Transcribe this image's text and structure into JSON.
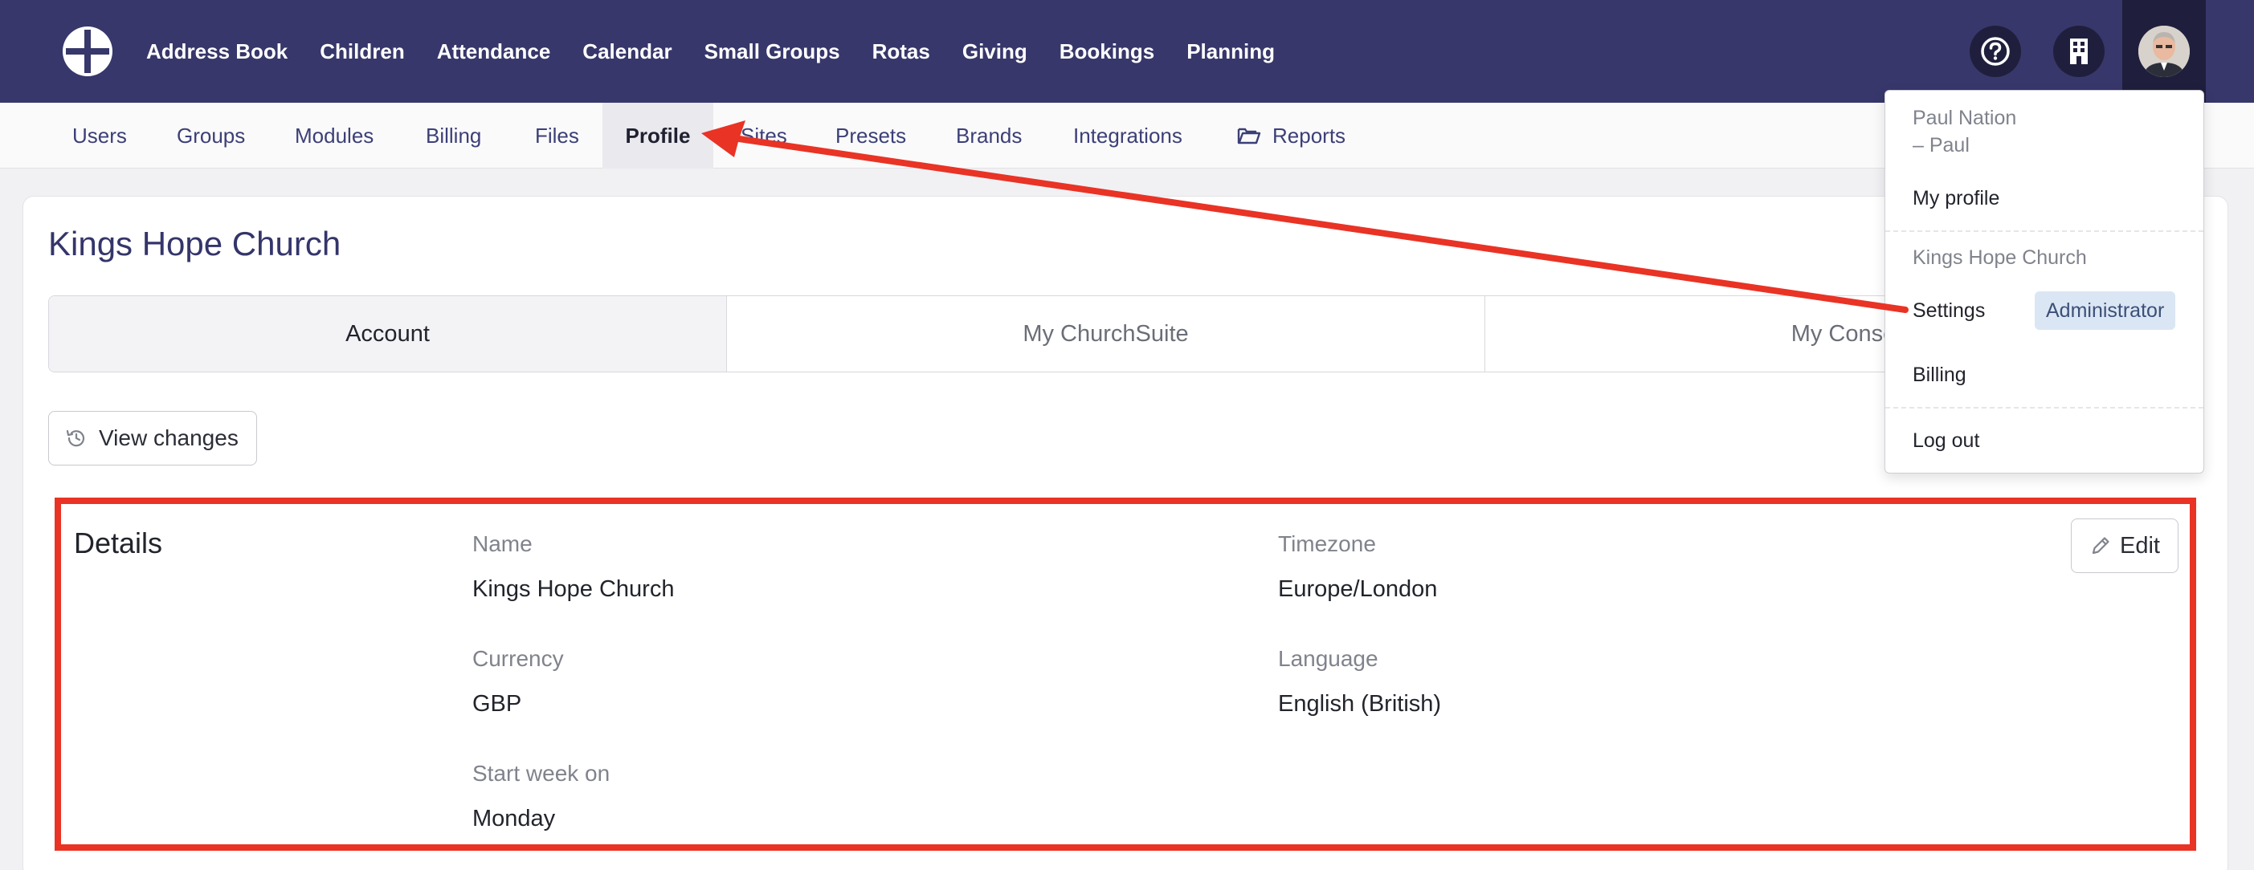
{
  "topnav": {
    "items": [
      "Address Book",
      "Children",
      "Attendance",
      "Calendar",
      "Small Groups",
      "Rotas",
      "Giving",
      "Bookings",
      "Planning"
    ]
  },
  "subnav": {
    "items": [
      "Users",
      "Groups",
      "Modules",
      "Billing",
      "Files",
      "Profile",
      "Sites",
      "Presets",
      "Brands",
      "Integrations",
      "Reports"
    ],
    "active": "Profile"
  },
  "page": {
    "title": "Kings Hope Church"
  },
  "tabs": [
    "Account",
    "My ChurchSuite",
    "My Conse"
  ],
  "view_changes_label": "View changes",
  "details": {
    "title": "Details",
    "edit_label": "Edit",
    "fields": {
      "name": {
        "label": "Name",
        "value": "Kings Hope Church"
      },
      "timezone": {
        "label": "Timezone",
        "value": "Europe/London"
      },
      "currency": {
        "label": "Currency",
        "value": "GBP"
      },
      "language": {
        "label": "Language",
        "value": "English (British)"
      },
      "start_week": {
        "label": "Start week on",
        "value": "Monday"
      }
    }
  },
  "dropdown": {
    "user_name": "Paul Nation",
    "user_short": "– Paul",
    "my_profile": "My profile",
    "org_name": "Kings Hope Church",
    "settings": "Settings",
    "role_badge": "Administrator",
    "billing": "Billing",
    "logout": "Log out"
  },
  "colors": {
    "topbar": "#37376b",
    "annotation": "#e93325",
    "badge": "#dbe6f4"
  }
}
